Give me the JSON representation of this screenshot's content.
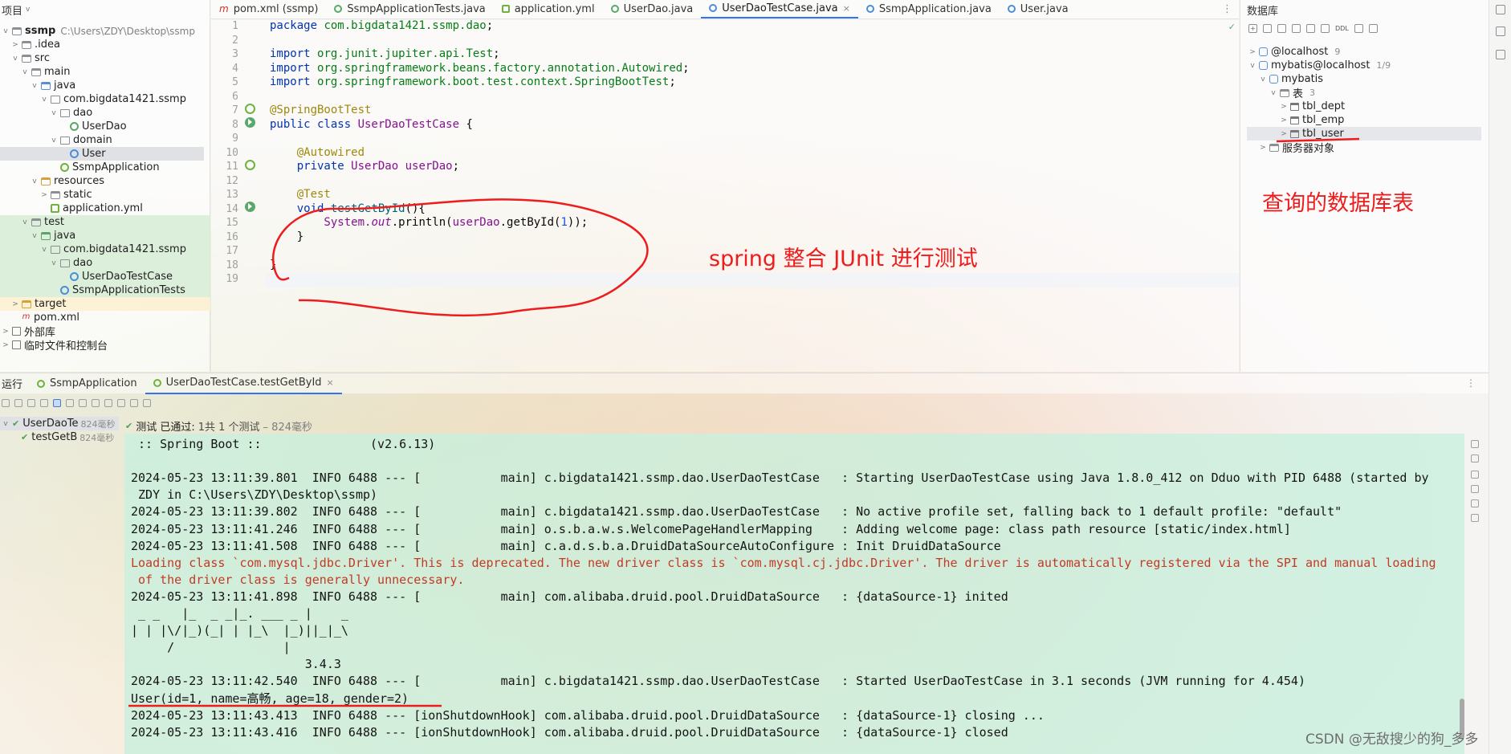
{
  "project": {
    "header": "项目",
    "tree": [
      {
        "label": "ssmp",
        "extra": "C:\\Users\\ZDY\\Desktop\\ssmp",
        "depth": 0,
        "chev": "v",
        "icon": "folder"
      },
      {
        "label": ".idea",
        "depth": 1,
        "chev": ">",
        "icon": "folder"
      },
      {
        "label": "src",
        "depth": 1,
        "chev": "v",
        "icon": "folder"
      },
      {
        "label": "main",
        "depth": 2,
        "chev": "v",
        "icon": "folder"
      },
      {
        "label": "java",
        "depth": 3,
        "chev": "v",
        "icon": "folder-src"
      },
      {
        "label": "com.bigdata1421.ssmp",
        "depth": 4,
        "chev": "v",
        "icon": "package"
      },
      {
        "label": "dao",
        "depth": 5,
        "chev": "v",
        "icon": "package"
      },
      {
        "label": "UserDao",
        "depth": 6,
        "chev": "",
        "icon": "interface"
      },
      {
        "label": "domain",
        "depth": 5,
        "chev": "v",
        "icon": "package"
      },
      {
        "label": "User",
        "depth": 6,
        "chev": "",
        "icon": "class"
      },
      {
        "label": "SsmpApplication",
        "depth": 5,
        "chev": "",
        "icon": "boot"
      },
      {
        "label": "resources",
        "depth": 3,
        "chev": "v",
        "icon": "folder-orange"
      },
      {
        "label": "static",
        "depth": 4,
        "chev": ">",
        "icon": "folder"
      },
      {
        "label": "application.yml",
        "depth": 4,
        "chev": "",
        "icon": "yml"
      },
      {
        "label": "test",
        "depth": 2,
        "chev": "v",
        "icon": "folder"
      },
      {
        "label": "java",
        "depth": 3,
        "chev": "v",
        "icon": "folder-green"
      },
      {
        "label": "com.bigdata1421.ssmp",
        "depth": 4,
        "chev": "v",
        "icon": "package"
      },
      {
        "label": "dao",
        "depth": 5,
        "chev": "v",
        "icon": "package"
      },
      {
        "label": "UserDaoTestCase",
        "depth": 6,
        "chev": "",
        "icon": "class"
      },
      {
        "label": "SsmpApplicationTests",
        "depth": 5,
        "chev": "",
        "icon": "class"
      },
      {
        "label": "target",
        "depth": 1,
        "chev": ">",
        "icon": "folder-orange"
      },
      {
        "label": "pom.xml",
        "depth": 1,
        "chev": "",
        "icon": "maven"
      },
      {
        "label": "外部库",
        "depth": 0,
        "chev": ">",
        "icon": "library"
      },
      {
        "label": "临时文件和控制台",
        "depth": 0,
        "chev": ">",
        "icon": "library"
      }
    ]
  },
  "editor": {
    "tabs": [
      {
        "label": "pom.xml (ssmp)",
        "icon": "maven"
      },
      {
        "label": "SsmpApplicationTests.java",
        "icon": "test"
      },
      {
        "label": "application.yml",
        "icon": "yml"
      },
      {
        "label": "UserDao.java",
        "icon": "interface"
      },
      {
        "label": "UserDaoTestCase.java",
        "icon": "class",
        "active": true,
        "close": "×"
      },
      {
        "label": "SsmpApplication.java",
        "icon": "class"
      },
      {
        "label": "User.java",
        "icon": "class"
      }
    ],
    "tabs_more": "⋮",
    "ok_mark": "✓",
    "line_numbers": [
      "1",
      "2",
      "3",
      "4",
      "5",
      "6",
      "7",
      "8",
      "9",
      "10",
      "11",
      "12",
      "13",
      "14",
      "15",
      "16",
      "17",
      "18",
      "19"
    ],
    "code": [
      [
        {
          "t": "package ",
          "c": "kw"
        },
        {
          "t": "com.bigdata1421.ssmp.dao",
          "c": "pk"
        },
        {
          "t": ";",
          "c": ""
        }
      ],
      [],
      [
        {
          "t": "import ",
          "c": "kw"
        },
        {
          "t": "org.junit.jupiter.api.",
          "c": "pk"
        },
        {
          "t": "Test",
          "c": "pk"
        },
        {
          "t": ";",
          "c": ""
        }
      ],
      [
        {
          "t": "import ",
          "c": "kw"
        },
        {
          "t": "org.springframework.beans.factory.annotation.",
          "c": "pk"
        },
        {
          "t": "Autowired",
          "c": "pk"
        },
        {
          "t": ";",
          "c": ""
        }
      ],
      [
        {
          "t": "import ",
          "c": "kw"
        },
        {
          "t": "org.springframework.boot.test.context.",
          "c": "pk"
        },
        {
          "t": "SpringBootTest",
          "c": "pk"
        },
        {
          "t": ";",
          "c": ""
        }
      ],
      [],
      [
        {
          "t": "@SpringBootTest",
          "c": "an"
        }
      ],
      [
        {
          "t": "public class ",
          "c": "kw"
        },
        {
          "t": "UserDaoTestCase",
          "c": "cls"
        },
        {
          "t": " {",
          "c": ""
        }
      ],
      [],
      [
        {
          "t": "    @Autowired",
          "c": "an"
        }
      ],
      [
        {
          "t": "    private ",
          "c": "kw"
        },
        {
          "t": "UserDao ",
          "c": "cls"
        },
        {
          "t": "userDao",
          "c": "fld"
        },
        {
          "t": ";",
          "c": ""
        }
      ],
      [],
      [
        {
          "t": "    @Test",
          "c": "an"
        }
      ],
      [
        {
          "t": "    void ",
          "c": "kw"
        },
        {
          "t": "testGetById",
          "c": "mth"
        },
        {
          "t": "(){",
          "c": ""
        }
      ],
      [
        {
          "t": "        System.",
          "c": "cls"
        },
        {
          "t": "out",
          "c": "st"
        },
        {
          "t": ".println(",
          "c": ""
        },
        {
          "t": "userDao",
          "c": "fld"
        },
        {
          "t": ".getById(",
          "c": ""
        },
        {
          "t": "1",
          "c": "num"
        },
        {
          "t": "));",
          "c": ""
        }
      ],
      [
        {
          "t": "    }",
          "c": ""
        }
      ],
      [],
      [
        {
          "t": "}",
          "c": ""
        }
      ],
      []
    ]
  },
  "database": {
    "title": "数据库",
    "toolbar_ddl": "DDL",
    "items": [
      {
        "label": "@localhost",
        "count": "9",
        "chev": ">",
        "depth": 0,
        "icon": "db"
      },
      {
        "label": "mybatis@localhost",
        "count": "1/9",
        "chev": "v",
        "depth": 0,
        "icon": "db"
      },
      {
        "label": "mybatis",
        "count": "",
        "chev": "v",
        "depth": 1,
        "icon": "db"
      },
      {
        "label": "表",
        "count": "3",
        "chev": "v",
        "depth": 2,
        "icon": "folder"
      },
      {
        "label": "tbl_dept",
        "count": "",
        "chev": ">",
        "depth": 3,
        "icon": "table"
      },
      {
        "label": "tbl_emp",
        "count": "",
        "chev": ">",
        "depth": 3,
        "icon": "table"
      },
      {
        "label": "tbl_user",
        "count": "",
        "chev": ">",
        "depth": 3,
        "icon": "table",
        "selected": true
      },
      {
        "label": "服务器对象",
        "count": "",
        "chev": ">",
        "depth": 1,
        "icon": "folder"
      }
    ]
  },
  "run": {
    "title": "运行",
    "tabs": [
      {
        "label": "SsmpApplication",
        "active": false
      },
      {
        "label": "UserDaoTestCase.testGetById",
        "active": true,
        "close": "×"
      }
    ],
    "more": "⋮",
    "test_tree": [
      {
        "label": "UserDaoTe",
        "time": "824毫秒",
        "chev": "v"
      },
      {
        "label": "testGetB",
        "time": "824毫秒",
        "chev": ""
      }
    ],
    "status": {
      "passed": "测试 已通过:",
      "count": "1共 1 个测试",
      "duration": "– 824毫秒"
    },
    "console": [
      {
        "text": " :: Spring Boot ::               (v2.6.13)",
        "err": false
      },
      {
        "text": "",
        "err": false
      },
      {
        "text": "2024-05-23 13:11:39.801  INFO 6488 --- [           main] c.bigdata1421.ssmp.dao.UserDaoTestCase   : Starting UserDaoTestCase using Java 1.8.0_412 on Dduo with PID 6488 (started by",
        "err": false
      },
      {
        "text": " ZDY in C:\\Users\\ZDY\\Desktop\\ssmp)",
        "err": false
      },
      {
        "text": "2024-05-23 13:11:39.802  INFO 6488 --- [           main] c.bigdata1421.ssmp.dao.UserDaoTestCase   : No active profile set, falling back to 1 default profile: \"default\"",
        "err": false
      },
      {
        "text": "2024-05-23 13:11:41.246  INFO 6488 --- [           main] o.s.b.a.w.s.WelcomePageHandlerMapping    : Adding welcome page: class path resource [static/index.html]",
        "err": false
      },
      {
        "text": "2024-05-23 13:11:41.508  INFO 6488 --- [           main] c.a.d.s.b.a.DruidDataSourceAutoConfigure : Init DruidDataSource",
        "err": false
      },
      {
        "text": "Loading class `com.mysql.jdbc.Driver'. This is deprecated. The new driver class is `com.mysql.cj.jdbc.Driver'. The driver is automatically registered via the SPI and manual loading",
        "err": true
      },
      {
        "text": " of the driver class is generally unnecessary.",
        "err": true
      },
      {
        "text": "2024-05-23 13:11:41.898  INFO 6488 --- [           main] com.alibaba.druid.pool.DruidDataSource   : {dataSource-1} inited",
        "err": false
      },
      {
        "text": " _ _   |_  _ _|_. ___ _ |    _",
        "err": false
      },
      {
        "text": "| | |\\/|_)(_| | |_\\  |_)||_|_\\",
        "err": false
      },
      {
        "text": "     /               |",
        "err": false
      },
      {
        "text": "                        3.4.3",
        "err": false
      },
      {
        "text": "2024-05-23 13:11:42.540  INFO 6488 --- [           main] c.bigdata1421.ssmp.dao.UserDaoTestCase   : Started UserDaoTestCase in 3.1 seconds (JVM running for 4.454)",
        "err": false
      },
      {
        "text": "User(id=1, name=高畅, age=18, gender=2)",
        "err": false
      },
      {
        "text": "2024-05-23 13:11:43.413  INFO 6488 --- [ionShutdownHook] com.alibaba.druid.pool.DruidDataSource   : {dataSource-1} closing ...",
        "err": false
      },
      {
        "text": "2024-05-23 13:11:43.416  INFO 6488 --- [ionShutdownHook] com.alibaba.druid.pool.DruidDataSource   : {dataSource-1} closed",
        "err": false
      }
    ]
  },
  "annotations": {
    "junit_label": "spring 整合 JUnit 进行测试",
    "db_label": "查询的数据库表",
    "color": "#ee1c1c"
  },
  "watermark": "CSDN @无敌搜少的狗_多多"
}
